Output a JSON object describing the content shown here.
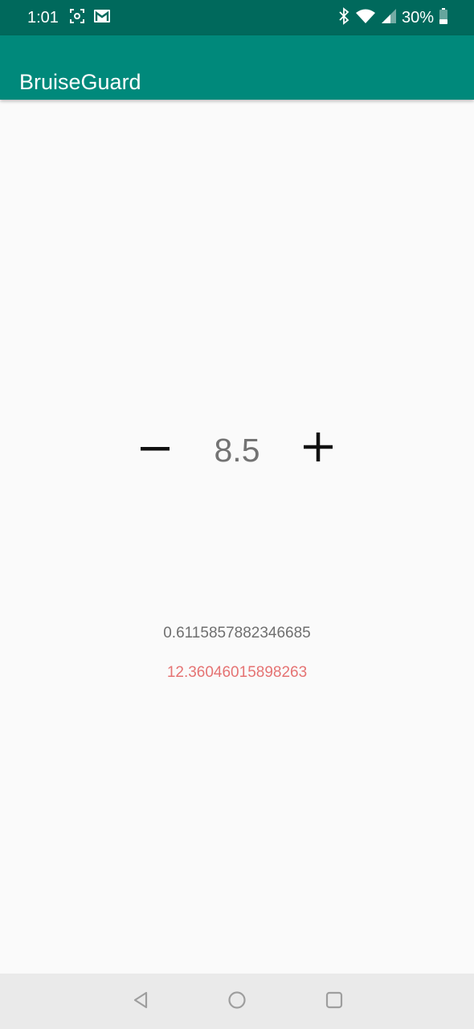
{
  "status_bar": {
    "time": "1:01",
    "battery_percent": "30%",
    "left_icons": [
      "screenshot-icon",
      "gmail-icon"
    ],
    "right_icons": [
      "bluetooth-icon",
      "wifi-icon",
      "cell-signal-icon",
      "battery-icon"
    ],
    "background": "#00695c"
  },
  "app_bar": {
    "title": "BruiseGuard",
    "background": "#00897b"
  },
  "stepper": {
    "decrement_icon": "minus-icon",
    "value": "8.5",
    "increment_icon": "plus-icon"
  },
  "results": {
    "primary": "0.6115857882346685",
    "secondary": "12.36046015898263",
    "secondary_color": "#e57373"
  },
  "nav_bar": {
    "buttons": [
      "back-icon",
      "home-icon",
      "recents-icon"
    ]
  }
}
